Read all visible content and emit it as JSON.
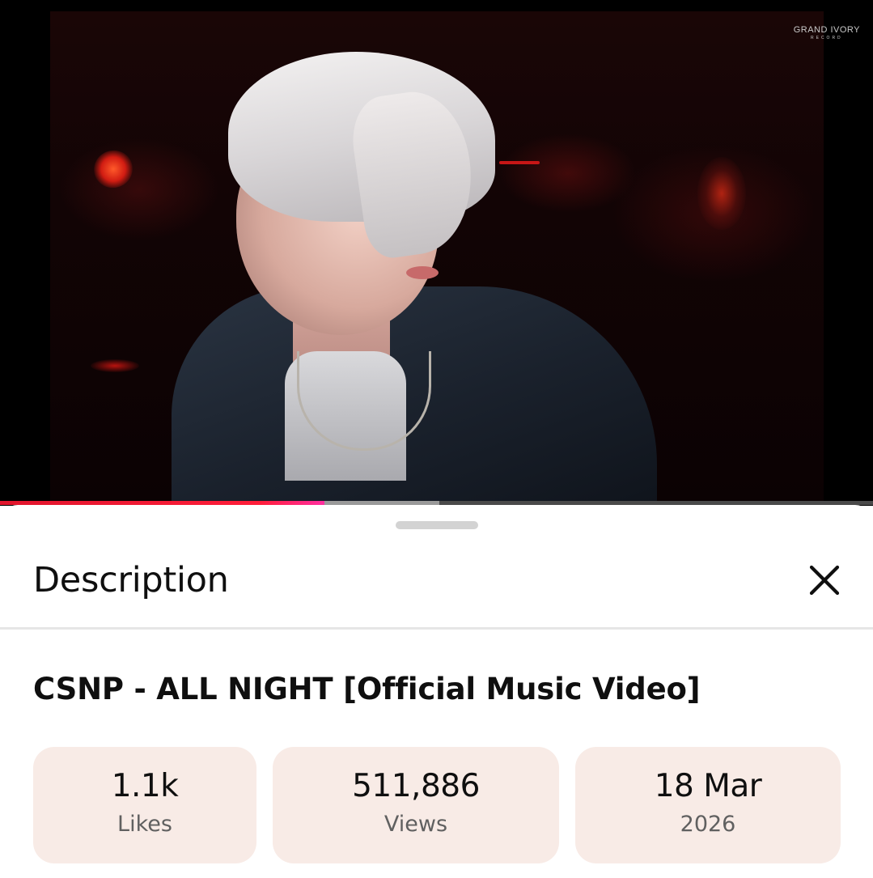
{
  "video": {
    "watermark": "GRAND IVORY",
    "watermark_sub": "RECORD",
    "progress": {
      "played_fraction": 0.372,
      "buffered_fraction": 0.503
    }
  },
  "sheet": {
    "title": "Description",
    "close_icon": "close-icon"
  },
  "details": {
    "video_title": "CSNP - ALL NIGHT [Official Music Video]",
    "stats": [
      {
        "value": "1.1k",
        "label": "Likes"
      },
      {
        "value": "511,886",
        "label": "Views"
      },
      {
        "value": "18 Mar",
        "label": "2026"
      }
    ]
  },
  "colors": {
    "progress_played": "#ff1e3a",
    "stat_chip_bg": "#f8ebe6"
  }
}
